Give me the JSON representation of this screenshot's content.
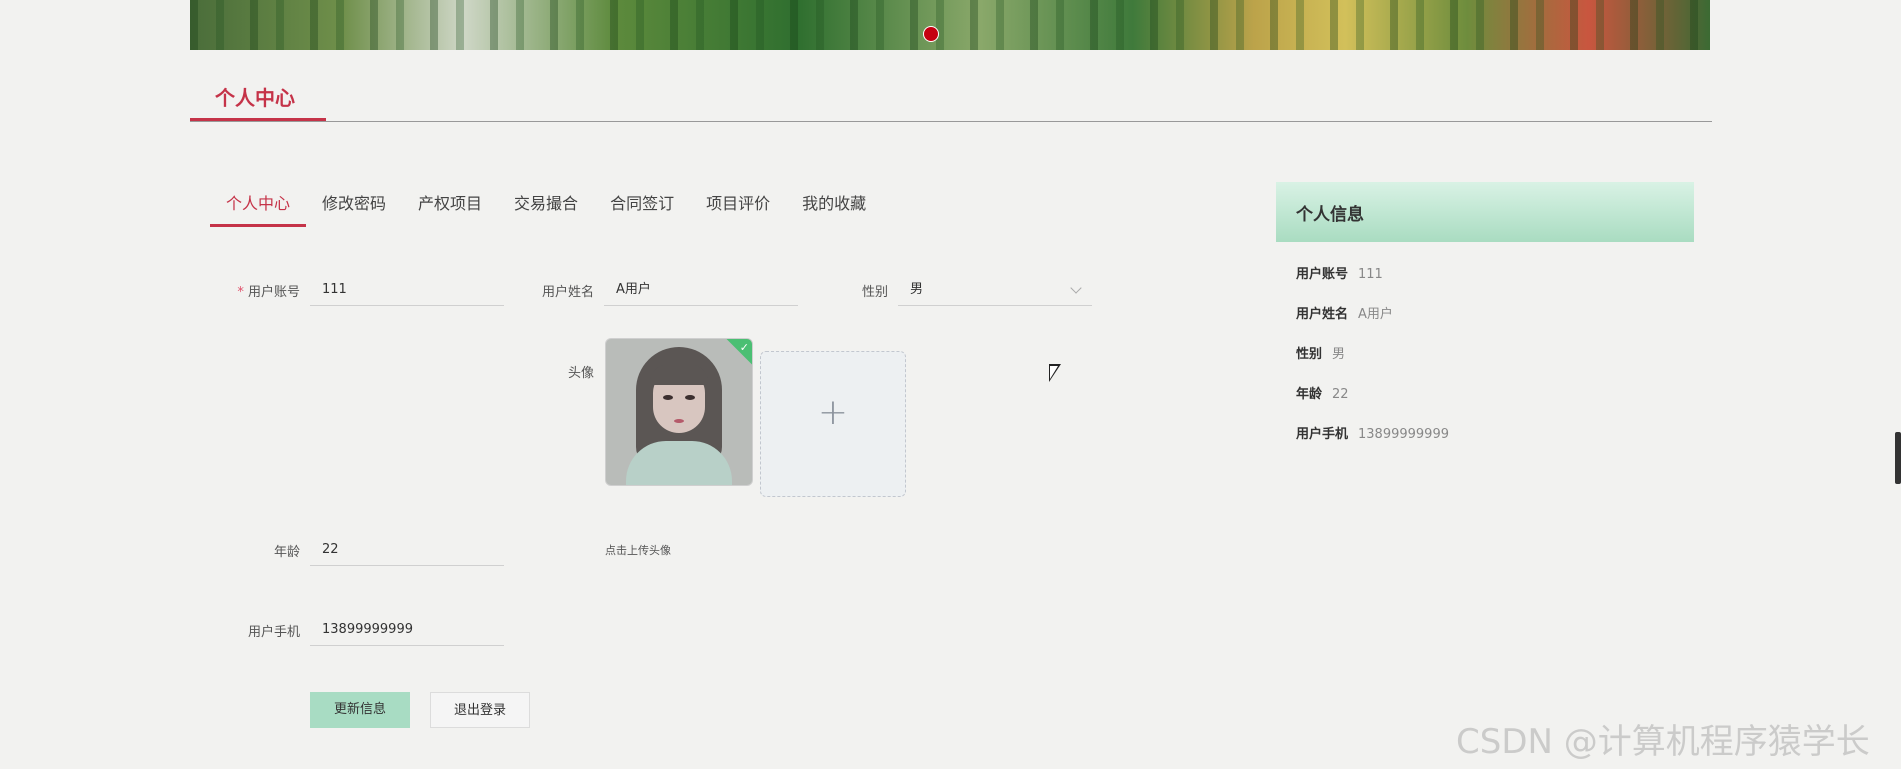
{
  "banner": {
    "indicator_color": "#c40010"
  },
  "section": {
    "title": "个人中心"
  },
  "tabs": [
    {
      "label": "个人中心",
      "active": true
    },
    {
      "label": "修改密码"
    },
    {
      "label": "产权项目"
    },
    {
      "label": "交易撮合"
    },
    {
      "label": "合同签订"
    },
    {
      "label": "项目评价"
    },
    {
      "label": "我的收藏"
    }
  ],
  "form": {
    "account": {
      "required_mark": "*",
      "label": "用户账号",
      "value": "111"
    },
    "name": {
      "label": "用户姓名",
      "value": "A用户"
    },
    "gender": {
      "label": "性别",
      "value": "男"
    },
    "avatar": {
      "label": "头像",
      "hint": "点击上传头像",
      "upload_icon": "plus-icon"
    },
    "age": {
      "label": "年龄",
      "value": "22"
    },
    "phone": {
      "label": "用户手机",
      "value": "13899999999"
    },
    "buttons": {
      "update": "更新信息",
      "logout": "退出登录"
    }
  },
  "info_card": {
    "title": "个人信息",
    "rows": [
      {
        "key": "用户账号",
        "value": "111"
      },
      {
        "key": "用户姓名",
        "value": "A用户"
      },
      {
        "key": "性别",
        "value": "男"
      },
      {
        "key": "年龄",
        "value": "22"
      },
      {
        "key": "用户手机",
        "value": "13899999999"
      }
    ]
  },
  "watermark": "CSDN @计算机程序猿学长",
  "colors": {
    "accent": "#c53348",
    "primary_button": "#a8dcc3",
    "card_header": "#a9dcc1"
  }
}
